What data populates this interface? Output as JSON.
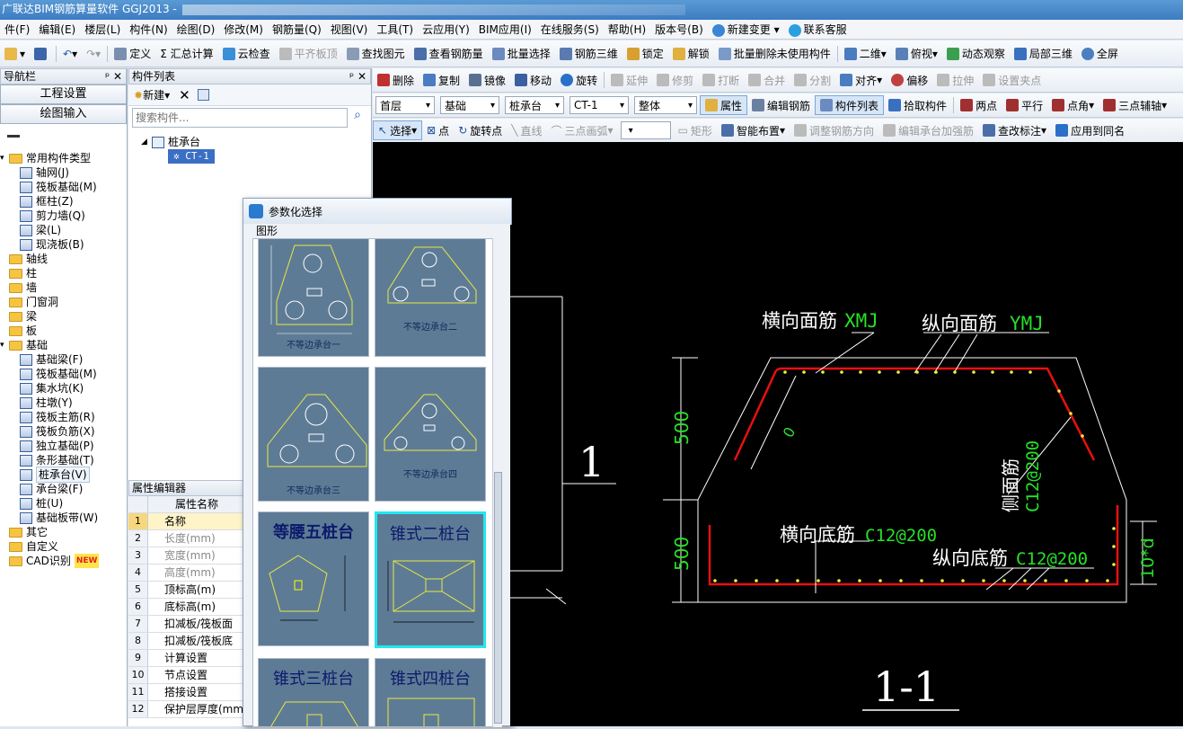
{
  "window": {
    "title": "广联达BIM钢筋算量软件 GGJ2013 -"
  },
  "menu": [
    "件(F)",
    "编辑(E)",
    "楼层(L)",
    "构件(N)",
    "绘图(D)",
    "修改(M)",
    "钢筋量(Q)",
    "视图(V)",
    "工具(T)",
    "云应用(Y)",
    "BIM应用(I)",
    "在线服务(S)",
    "帮助(H)",
    "版本号(B)",
    "新建变更",
    "联系客服"
  ],
  "toolbar1": [
    "定义",
    "Σ 汇总计算",
    "云检查",
    "平齐板顶",
    "查找图元",
    "查看钢筋量",
    "批量选择",
    "钢筋三维",
    "锁定",
    "解锁",
    "批量删除未使用构件",
    "二维",
    "俯视",
    "动态观察",
    "局部三维",
    "全屏"
  ],
  "toolbar2": [
    "删除",
    "复制",
    "镜像",
    "移动",
    "旋转",
    "延伸",
    "修剪",
    "打断",
    "合并",
    "分割",
    "对齐",
    "偏移",
    "拉伸",
    "设置夹点"
  ],
  "toolbar3": {
    "floor": "首层",
    "category": "基础",
    "type": "桩承台",
    "component": "CT-1",
    "scope": "整体",
    "buttons": [
      "属性",
      "编辑钢筋",
      "构件列表",
      "拾取构件",
      "两点",
      "平行",
      "点角",
      "三点辅轴"
    ]
  },
  "toolbar4": [
    "选择",
    "点",
    "旋转点",
    "直线",
    "三点画弧",
    "矩形",
    "智能布置",
    "调整钢筋方向",
    "编辑承台加强筋",
    "查改标注",
    "应用到同名"
  ],
  "nav": {
    "title": "导航栏",
    "project_settings": "工程设置",
    "drawing_input": "绘图输入",
    "root": "常用构件类型",
    "common": [
      "轴网(J)",
      "筏板基础(M)",
      "框柱(Z)",
      "剪力墙(Q)",
      "梁(L)",
      "现浇板(B)"
    ],
    "folders1": [
      "轴线",
      "柱",
      "墙",
      "门窗洞",
      "梁",
      "板",
      "基础"
    ],
    "foundation": [
      "基础梁(F)",
      "筏板基础(M)",
      "集水坑(K)",
      "柱墩(Y)",
      "筏板主筋(R)",
      "筏板负筋(X)",
      "独立基础(P)",
      "条形基础(T)",
      "桩承台(V)",
      "承台梁(F)",
      "桩(U)",
      "基础板带(W)"
    ],
    "folders2": [
      "其它",
      "自定义",
      "CAD识别"
    ],
    "new_badge": "NEW"
  },
  "component_list": {
    "title": "构件列表",
    "new_label": "新建",
    "search_placeholder": "搜索构件...",
    "tree_root": "桩承台",
    "tree_item": "CT-1"
  },
  "property_editor": {
    "title": "属性编辑器",
    "header": "属性名称",
    "rows": [
      "名称",
      "长度(mm)",
      "宽度(mm)",
      "高度(mm)",
      "顶标高(m)",
      "底标高(m)",
      "扣减板/筏板面",
      "扣减板/筏板底",
      "计算设置",
      "节点设置",
      "搭接设置",
      "保护层厚度(mm"
    ]
  },
  "dialog": {
    "title": "参数化选择",
    "group": "图形",
    "items": [
      "不等边承台一",
      "不等边承台二",
      "不等边承台三",
      "不等边承台四",
      "等腰五桩台",
      "锥式二桩台",
      "锥式三桩台",
      "锥式四桩台"
    ]
  },
  "drawing": {
    "top_rebar_h": "横向面筋",
    "top_rebar_h_code": "XMJ",
    "top_rebar_v": "纵向面筋",
    "top_rebar_v_code": "YMJ",
    "side_rebar": "侧面筋",
    "side_rebar_code": "C12@200",
    "bottom_h": "横向底筋",
    "bottom_h_code": "C12@200",
    "bottom_v": "纵向底筋",
    "bottom_v_code": "C12@200",
    "dim1": "500",
    "dim2": "500",
    "dim_d": "10*d",
    "slope": "0",
    "section_mark": "1",
    "section_title": "1-1"
  }
}
